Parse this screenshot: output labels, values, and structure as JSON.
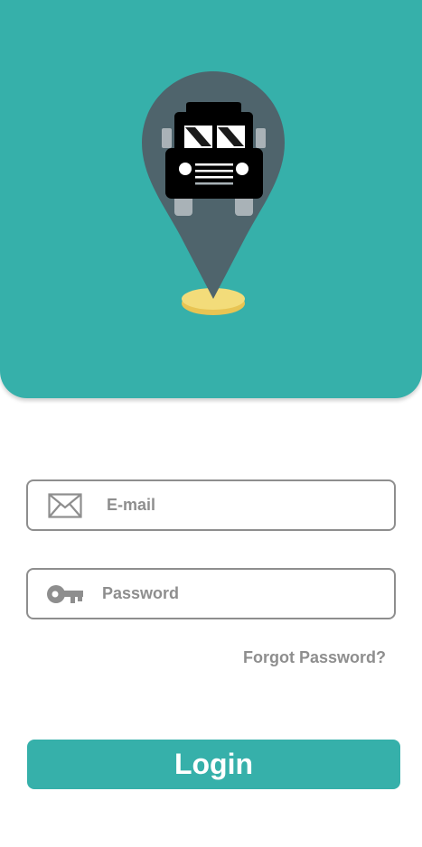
{
  "colors": {
    "primary": "#36b0aa",
    "pin": "#4f646c",
    "field_border": "#8e8e8e",
    "placeholder": "#8e8e8e",
    "button_text": "#ffffff",
    "base_disc": "#f2d872"
  },
  "header": {
    "logo_icon": "truck-location-pin-icon"
  },
  "form": {
    "email": {
      "icon": "envelope-icon",
      "placeholder": "E-mail",
      "value": ""
    },
    "password": {
      "icon": "key-icon",
      "placeholder": "Password",
      "value": ""
    },
    "forgot_label": "Forgot Password?",
    "login_label": "Login"
  }
}
